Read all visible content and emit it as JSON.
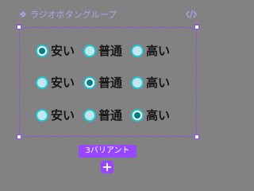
{
  "colors": {
    "background": "#828282",
    "accent": "#9747ff",
    "accent_light": "#b4a2ee",
    "radio_ring": "#22c3d2",
    "radio_unchecked_fill": "#bfe8ec",
    "radio_dot": "#007d8a"
  },
  "component_set": {
    "icon": "component-set-icon",
    "title": "ラジオボタングループ",
    "code_icon": "code-icon"
  },
  "groups": [
    {
      "options": [
        {
          "label": "安い",
          "checked": true
        },
        {
          "label": "普通",
          "checked": false
        },
        {
          "label": "高い",
          "checked": false
        }
      ]
    },
    {
      "options": [
        {
          "label": "安い",
          "checked": false
        },
        {
          "label": "普通",
          "checked": true
        },
        {
          "label": "高い",
          "checked": false
        }
      ]
    },
    {
      "options": [
        {
          "label": "安い",
          "checked": false
        },
        {
          "label": "普通",
          "checked": false
        },
        {
          "label": "高い",
          "checked": true
        }
      ]
    }
  ],
  "variant_badge": "3バリアント",
  "add_variant_label": "+"
}
